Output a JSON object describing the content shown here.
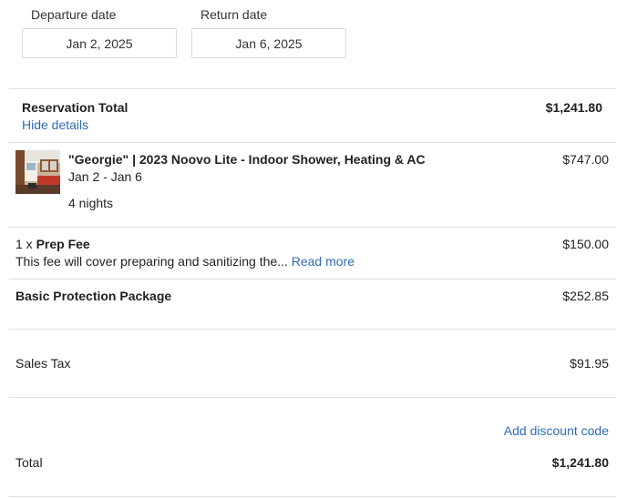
{
  "dates": {
    "departure_label": "Departure date",
    "departure_value": "Jan 2, 2025",
    "return_label": "Return date",
    "return_value": "Jan 6, 2025"
  },
  "reservation": {
    "title": "Reservation Total",
    "amount": "$1,241.80",
    "toggle_details": "Hide details"
  },
  "line_items": {
    "rental": {
      "title": "\"Georgie\" | 2023 Noovo Lite - Indoor Shower, Heating & AC",
      "date_range": "Jan 2 - Jan 6",
      "nights": "4 nights",
      "amount": "$747.00"
    },
    "prep_fee": {
      "quantity": "1 x ",
      "title": "Prep Fee",
      "description": "This fee will cover preparing and sanitizing the...",
      "read_more": "Read more",
      "amount": "$150.00"
    },
    "protection": {
      "title": "Basic Protection Package",
      "amount": "$252.85"
    },
    "sales_tax": {
      "title": "Sales Tax",
      "amount": "$91.95"
    }
  },
  "discount": {
    "label": "Add discount code"
  },
  "total": {
    "label": "Total",
    "amount": "$1,241.80"
  },
  "colors": {
    "link": "#2d6cb2",
    "divider": "#dedede"
  }
}
